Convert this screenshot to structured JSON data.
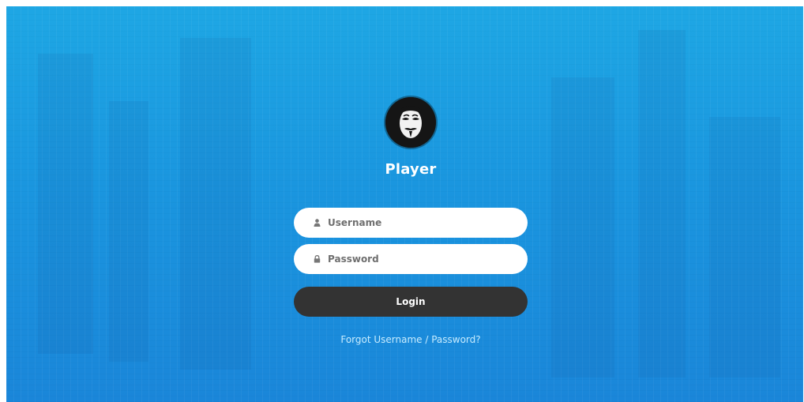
{
  "profile": {
    "name": "Player",
    "avatar_icon": "anonymous-mask-icon"
  },
  "form": {
    "username_placeholder": "Username",
    "password_placeholder": "Password",
    "username_icon": "user-icon",
    "password_icon": "lock-icon",
    "login_label": "Login",
    "forgot_link": "Forgot Username / Password?"
  },
  "colors": {
    "background_top": "#1ea7e4",
    "background_bottom": "#1a86d9",
    "button": "#333333",
    "input": "#ffffff",
    "link": "#c7ecff"
  }
}
